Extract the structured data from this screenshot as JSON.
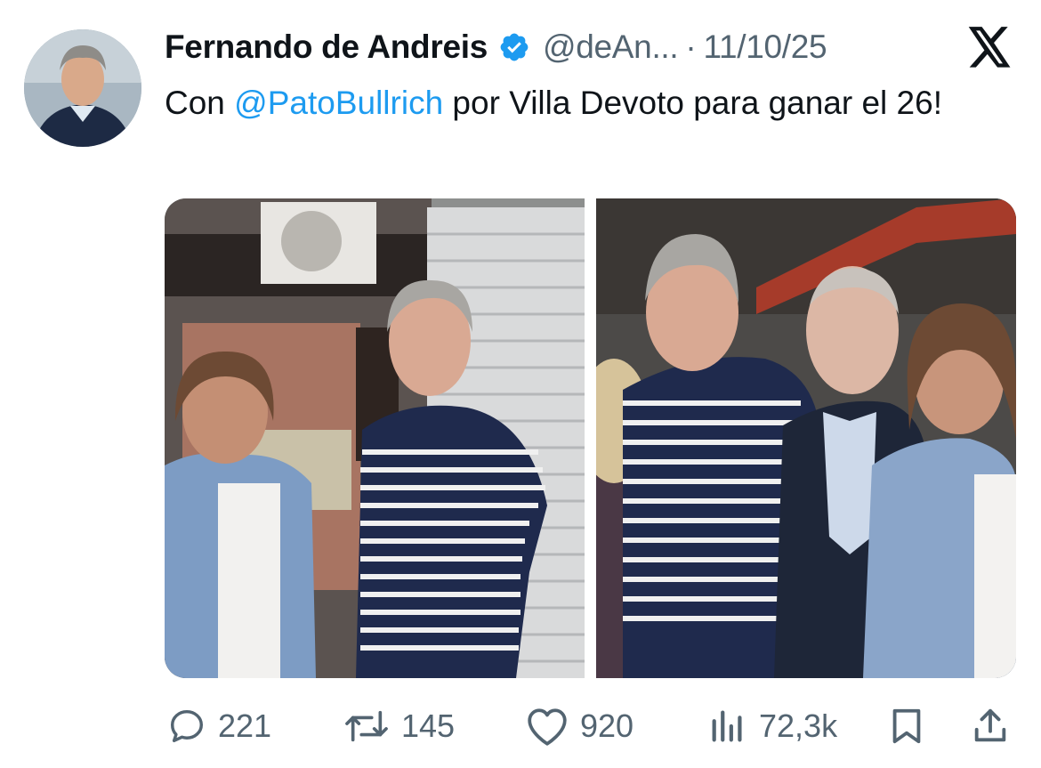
{
  "tweet": {
    "author_name": "Fernando de Andreis",
    "handle": "@deAn...",
    "separator": "·",
    "date": "11/10/25",
    "text_prefix": "Con ",
    "mention": "@PatoBullrich",
    "text_suffix": " por Villa Devoto para ganar el 26!",
    "verified": true,
    "media": [
      {
        "kind": "photo",
        "icon": "photo-left"
      },
      {
        "kind": "photo",
        "icon": "photo-right"
      }
    ]
  },
  "actions": {
    "replies": "221",
    "reposts": "145",
    "likes": "920",
    "views": "72,3k"
  },
  "icons": {
    "brand": "x-logo-icon",
    "verified": "verified-badge-icon",
    "reply": "reply-icon",
    "repost": "repost-icon",
    "like": "heart-icon",
    "views": "views-chart-icon",
    "bookmark": "bookmark-icon",
    "share": "share-icon"
  },
  "colors": {
    "mention": "#1d9bf0",
    "verified": "#1d9bf0",
    "secondary_text": "#536471"
  }
}
